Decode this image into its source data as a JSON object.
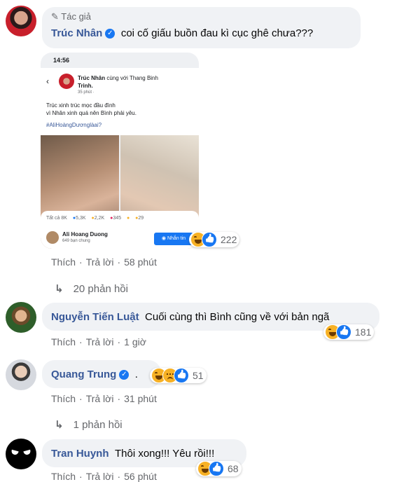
{
  "comments": [
    {
      "id": "c1",
      "badge": "Tác giả",
      "author": "Trúc Nhân",
      "verified": true,
      "text": "coi cố giấu buồn đau kì cục ghê chưa???",
      "reactions": [
        "haha",
        "like"
      ],
      "reaction_count": "222",
      "actions": {
        "like": "Thích",
        "reply": "Trả lời",
        "time": "58 phút"
      },
      "replies_link": "20 phản hồi",
      "attachment": {
        "status_time": "14:56",
        "post_author": "Trúc Nhân",
        "with_text": "cùng với Thang Binh",
        "with_text_2": "Trinh.",
        "post_time": "35 phút ·",
        "post_body_1": "Trúc xinh trúc mọc đầu đình",
        "post_body_2": "vì Nhân xinh quá nên Bình phải yêu.",
        "hashtag": "#AliHoàngDươnglàai?",
        "stats": {
          "all": "Tất cả 8K",
          "like": "5,3K",
          "haha": "2,2K",
          "love": "345",
          "wow": "",
          "sad": "29"
        },
        "profile_name": "Ali Hoang Duong",
        "mutual": "649 bạn chung",
        "message_button": "Nhắn tin"
      }
    },
    {
      "id": "c2",
      "author": "Nguyễn Tiến Luật",
      "verified": false,
      "text": "Cuối cùng thì Bình cũng về với bản ngã",
      "reactions": [
        "haha",
        "like"
      ],
      "reaction_count": "181",
      "actions": {
        "like": "Thích",
        "reply": "Trả lời",
        "time": "1 giờ"
      }
    },
    {
      "id": "c3",
      "author": "Quang Trung",
      "verified": true,
      "text": ".",
      "reactions": [
        "haha",
        "sad",
        "like"
      ],
      "reaction_count": "51",
      "actions": {
        "like": "Thích",
        "reply": "Trả lời",
        "time": "31 phút"
      },
      "replies_link": "1 phản hồi"
    },
    {
      "id": "c4",
      "author": "Tran Huynh",
      "verified": false,
      "text": "Thôi xong!!! Yêu rồi!!!",
      "reactions": [
        "haha",
        "like"
      ],
      "reaction_count": "68",
      "actions": {
        "like": "Thích",
        "reply": "Trả lời",
        "time": "56 phút"
      }
    }
  ],
  "colors": {
    "name": "#385898",
    "bubble": "#f0f2f5",
    "meta": "#65676b",
    "like": "#1877f2",
    "haha": "#f7b125"
  }
}
